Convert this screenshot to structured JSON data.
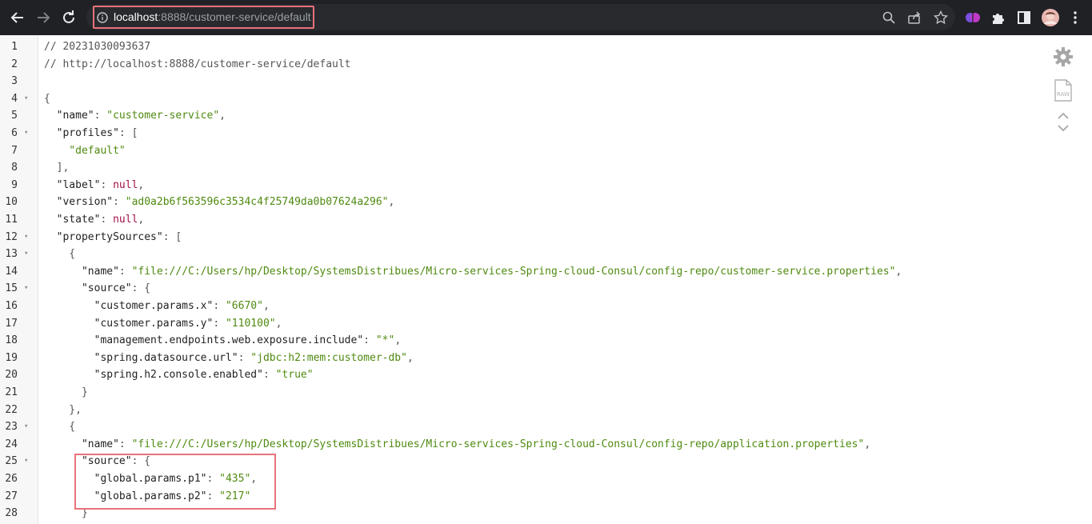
{
  "browser": {
    "url_host": "localhost",
    "url_rest": ":8888/customer-service/default"
  },
  "icons": {
    "back": "arrow-left-icon",
    "forward": "arrow-right-icon",
    "reload": "reload-icon",
    "info": "info-icon",
    "zoom": "zoom-icon",
    "share": "share-icon",
    "bookmark": "star-icon",
    "extension_brain": "brain-extension-icon",
    "extensions": "puzzle-icon",
    "sidepanel": "side-panel-icon",
    "profile": "avatar",
    "menu": "kebab-menu-icon",
    "settings": "gear-icon",
    "raw": "raw-icon",
    "collapse": "chevron-up-icon",
    "expand": "chevron-down-icon"
  },
  "json_lines": [
    {
      "n": "1",
      "fold": false,
      "parts": [
        {
          "t": "// 20231030093637",
          "c": "c"
        }
      ]
    },
    {
      "n": "2",
      "fold": false,
      "parts": [
        {
          "t": "// http://localhost:8888/customer-service/default",
          "c": "c"
        }
      ]
    },
    {
      "n": "3",
      "fold": false,
      "parts": []
    },
    {
      "n": "4",
      "fold": true,
      "parts": [
        {
          "t": "{",
          "c": "p"
        }
      ]
    },
    {
      "n": "5",
      "fold": false,
      "parts": [
        {
          "t": "  \"name\"",
          "c": "k"
        },
        {
          "t": ": ",
          "c": "p"
        },
        {
          "t": "\"customer-service\"",
          "c": "s"
        },
        {
          "t": ",",
          "c": "p"
        }
      ]
    },
    {
      "n": "6",
      "fold": true,
      "parts": [
        {
          "t": "  \"profiles\"",
          "c": "k"
        },
        {
          "t": ": [",
          "c": "p"
        }
      ]
    },
    {
      "n": "7",
      "fold": false,
      "parts": [
        {
          "t": "    \"default\"",
          "c": "s"
        }
      ]
    },
    {
      "n": "8",
      "fold": false,
      "parts": [
        {
          "t": "  ],",
          "c": "p"
        }
      ]
    },
    {
      "n": "9",
      "fold": false,
      "parts": [
        {
          "t": "  \"label\"",
          "c": "k"
        },
        {
          "t": ": ",
          "c": "p"
        },
        {
          "t": "null",
          "c": "n"
        },
        {
          "t": ",",
          "c": "p"
        }
      ]
    },
    {
      "n": "10",
      "fold": false,
      "parts": [
        {
          "t": "  \"version\"",
          "c": "k"
        },
        {
          "t": ": ",
          "c": "p"
        },
        {
          "t": "\"ad0a2b6f563596c3534c4f25749da0b07624a296\"",
          "c": "s"
        },
        {
          "t": ",",
          "c": "p"
        }
      ]
    },
    {
      "n": "11",
      "fold": false,
      "parts": [
        {
          "t": "  \"state\"",
          "c": "k"
        },
        {
          "t": ": ",
          "c": "p"
        },
        {
          "t": "null",
          "c": "n"
        },
        {
          "t": ",",
          "c": "p"
        }
      ]
    },
    {
      "n": "12",
      "fold": true,
      "parts": [
        {
          "t": "  \"propertySources\"",
          "c": "k"
        },
        {
          "t": ": [",
          "c": "p"
        }
      ]
    },
    {
      "n": "13",
      "fold": true,
      "parts": [
        {
          "t": "    {",
          "c": "p"
        }
      ]
    },
    {
      "n": "14",
      "fold": false,
      "parts": [
        {
          "t": "      \"name\"",
          "c": "k"
        },
        {
          "t": ": ",
          "c": "p"
        },
        {
          "t": "\"file:///C:/Users/hp/Desktop/SystemsDistribues/Micro-services-Spring-cloud-Consul/config-repo/customer-service.properties\"",
          "c": "s"
        },
        {
          "t": ",",
          "c": "p"
        }
      ]
    },
    {
      "n": "15",
      "fold": true,
      "parts": [
        {
          "t": "      \"source\"",
          "c": "k"
        },
        {
          "t": ": {",
          "c": "p"
        }
      ]
    },
    {
      "n": "16",
      "fold": false,
      "parts": [
        {
          "t": "        \"customer.params.x\"",
          "c": "k"
        },
        {
          "t": ": ",
          "c": "p"
        },
        {
          "t": "\"6670\"",
          "c": "s"
        },
        {
          "t": ",",
          "c": "p"
        }
      ]
    },
    {
      "n": "17",
      "fold": false,
      "parts": [
        {
          "t": "        \"customer.params.y\"",
          "c": "k"
        },
        {
          "t": ": ",
          "c": "p"
        },
        {
          "t": "\"110100\"",
          "c": "s"
        },
        {
          "t": ",",
          "c": "p"
        }
      ]
    },
    {
      "n": "18",
      "fold": false,
      "parts": [
        {
          "t": "        \"management.endpoints.web.exposure.include\"",
          "c": "k"
        },
        {
          "t": ": ",
          "c": "p"
        },
        {
          "t": "\"*\"",
          "c": "s"
        },
        {
          "t": ",",
          "c": "p"
        }
      ]
    },
    {
      "n": "19",
      "fold": false,
      "parts": [
        {
          "t": "        \"spring.datasource.url\"",
          "c": "k"
        },
        {
          "t": ": ",
          "c": "p"
        },
        {
          "t": "\"jdbc:h2:mem:customer-db\"",
          "c": "s"
        },
        {
          "t": ",",
          "c": "p"
        }
      ]
    },
    {
      "n": "20",
      "fold": false,
      "parts": [
        {
          "t": "        \"spring.h2.console.enabled\"",
          "c": "k"
        },
        {
          "t": ": ",
          "c": "p"
        },
        {
          "t": "\"true\"",
          "c": "s"
        }
      ]
    },
    {
      "n": "21",
      "fold": false,
      "parts": [
        {
          "t": "      }",
          "c": "p"
        }
      ]
    },
    {
      "n": "22",
      "fold": false,
      "parts": [
        {
          "t": "    },",
          "c": "p"
        }
      ]
    },
    {
      "n": "23",
      "fold": true,
      "parts": [
        {
          "t": "    {",
          "c": "p"
        }
      ]
    },
    {
      "n": "24",
      "fold": false,
      "parts": [
        {
          "t": "      \"name\"",
          "c": "k"
        },
        {
          "t": ": ",
          "c": "p"
        },
        {
          "t": "\"file:///C:/Users/hp/Desktop/SystemsDistribues/Micro-services-Spring-cloud-Consul/config-repo/application.properties\"",
          "c": "s"
        },
        {
          "t": ",",
          "c": "p"
        }
      ]
    },
    {
      "n": "25",
      "fold": true,
      "parts": [
        {
          "t": "      \"source\"",
          "c": "k"
        },
        {
          "t": ": {",
          "c": "p"
        }
      ]
    },
    {
      "n": "26",
      "fold": false,
      "parts": [
        {
          "t": "        \"global.params.p1\"",
          "c": "k"
        },
        {
          "t": ": ",
          "c": "p"
        },
        {
          "t": "\"435\"",
          "c": "s"
        },
        {
          "t": ",",
          "c": "p"
        }
      ]
    },
    {
      "n": "27",
      "fold": false,
      "parts": [
        {
          "t": "        \"global.params.p2\"",
          "c": "k"
        },
        {
          "t": ": ",
          "c": "p"
        },
        {
          "t": "\"217\"",
          "c": "s"
        }
      ]
    },
    {
      "n": "28",
      "fold": false,
      "parts": [
        {
          "t": "      }",
          "c": "p"
        }
      ]
    }
  ],
  "colors": {
    "highlight_border": "#e8737a",
    "string": "#4f8a10",
    "null": "#a4114a",
    "chrome_bg": "#202124"
  }
}
